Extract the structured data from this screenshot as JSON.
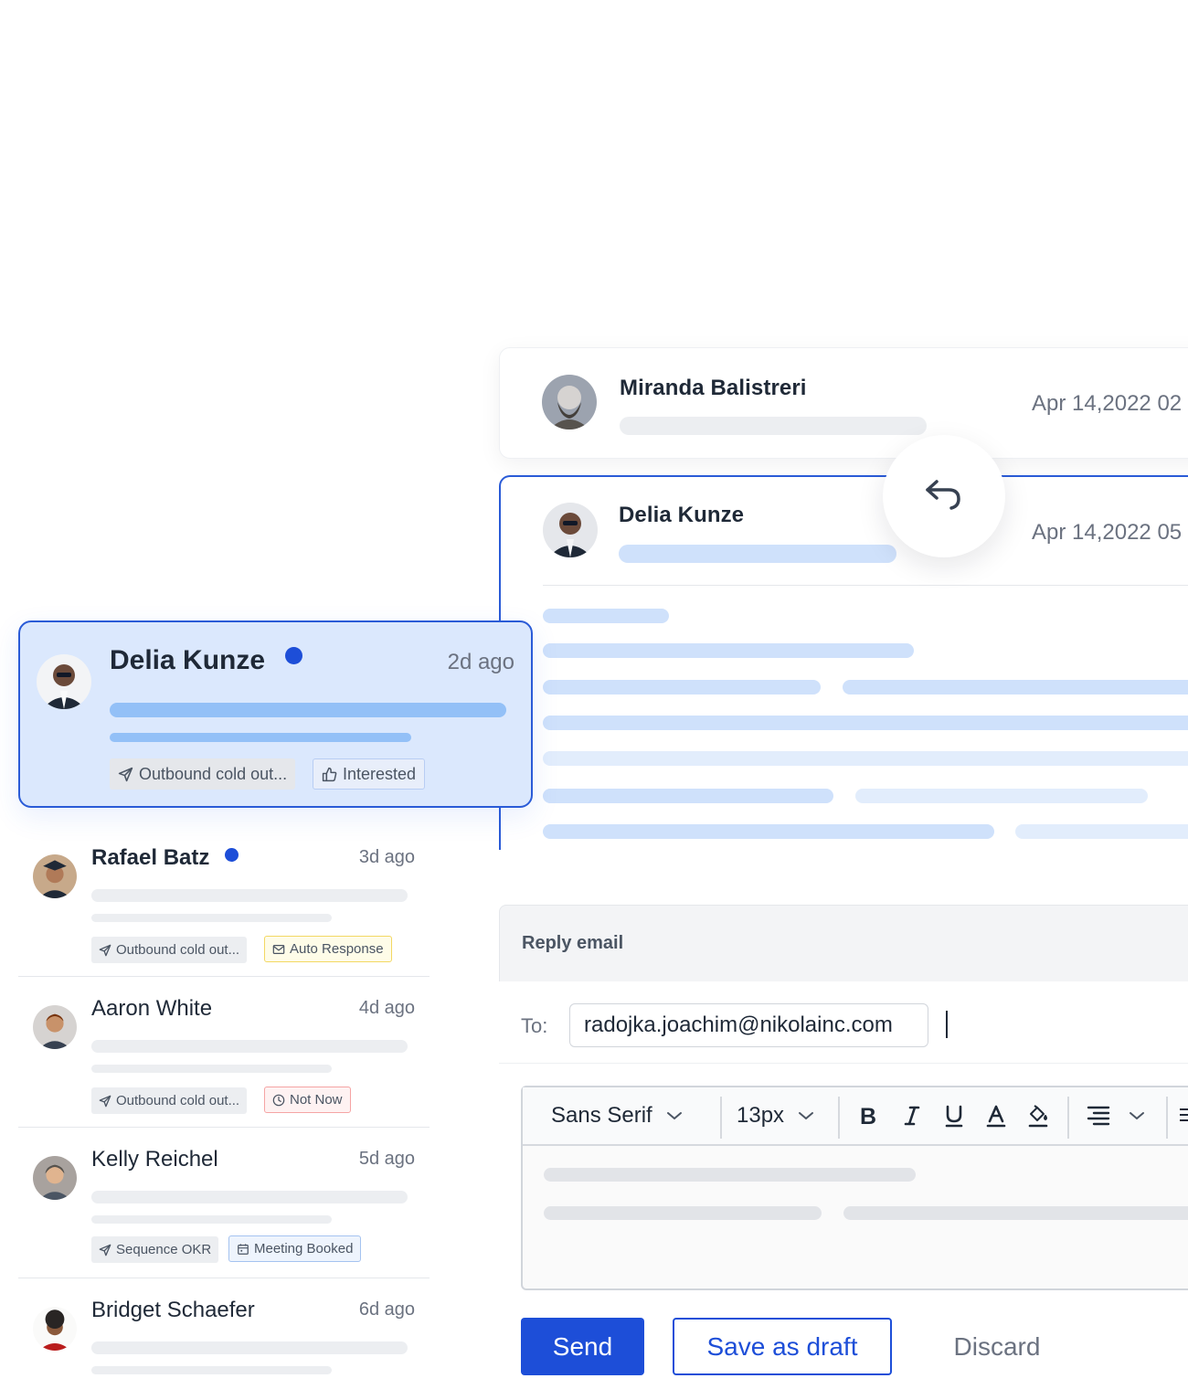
{
  "thread": [
    {
      "name": "Miranda Balistreri",
      "date": "Apr 14,2022 02"
    },
    {
      "name": "Delia Kunze",
      "date": "Apr 14,2022 05"
    }
  ],
  "reply_icon": "reply-arrow-icon",
  "inbox": {
    "active": {
      "name": "Delia Kunze",
      "time": "2d ago",
      "unread": true,
      "tags": [
        {
          "icon": "send-icon",
          "label": "Outbound cold out..."
        },
        {
          "icon": "thumbs-up-icon",
          "label": "Interested"
        }
      ]
    },
    "items": [
      {
        "name": "Rafael Batz",
        "time": "3d ago",
        "unread": true,
        "tags": [
          {
            "icon": "send-icon",
            "label": "Outbound cold out..."
          },
          {
            "icon": "auto-response-icon",
            "label": "Auto Response"
          }
        ]
      },
      {
        "name": "Aaron White",
        "time": "4d ago",
        "unread": false,
        "tags": [
          {
            "icon": "send-icon",
            "label": "Outbound cold out..."
          },
          {
            "icon": "clock-icon",
            "label": "Not Now"
          }
        ]
      },
      {
        "name": "Kelly Reichel",
        "time": "5d ago",
        "unread": false,
        "tags": [
          {
            "icon": "send-icon",
            "label": "Sequence OKR"
          },
          {
            "icon": "calendar-icon",
            "label": "Meeting Booked"
          }
        ]
      },
      {
        "name": "Bridget Schaefer",
        "time": "6d ago",
        "unread": false,
        "tags": []
      }
    ]
  },
  "composer": {
    "header": "Reply email",
    "to_label": "To:",
    "to_value": "radojka.joachim@nikolainc.com",
    "font_family": "Sans Serif",
    "font_size": "13px",
    "send_label": "Send",
    "draft_label": "Save as draft",
    "discard_label": "Discard"
  },
  "colors": {
    "accent": "#1d4ed8",
    "active_bg": "#dbe8fd",
    "tag_yellow_border": "#f3d863",
    "tag_red_border": "#f5a4a4",
    "tag_blue_border": "#a5c3f0"
  }
}
